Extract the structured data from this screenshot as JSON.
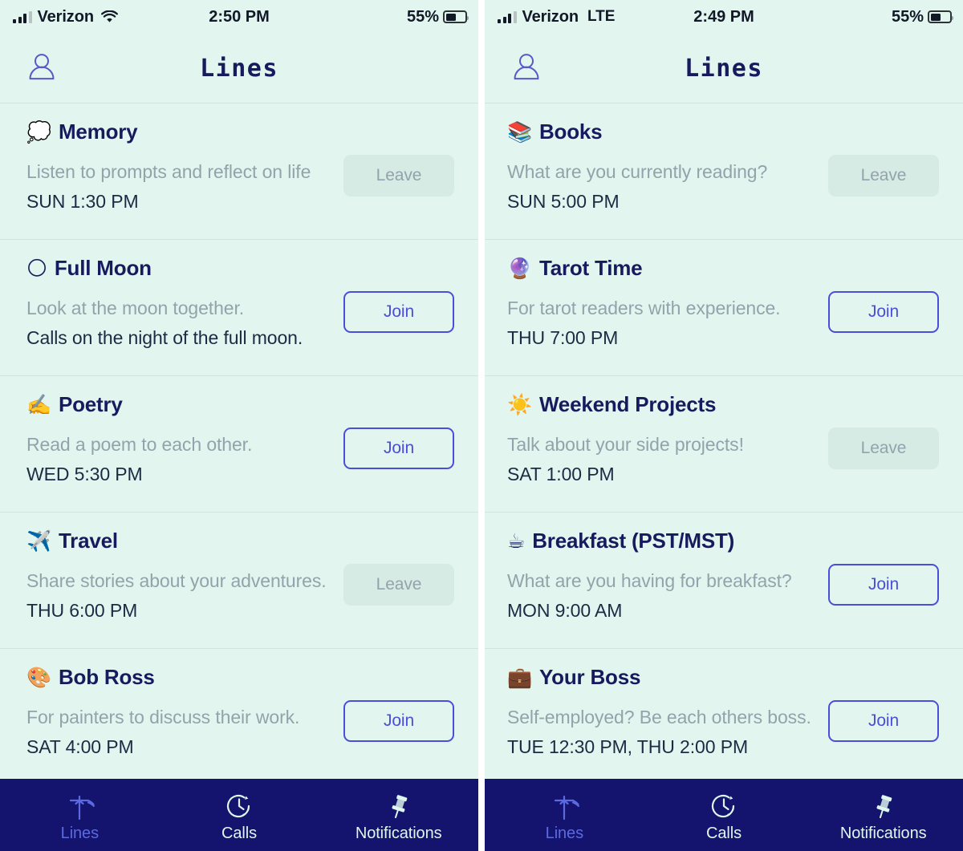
{
  "app": {
    "title": "Lines",
    "accent_indigo": "#4b4ddb",
    "title_navy": "#181a5e",
    "background_mint": "#e2f6ef",
    "tabbar_navy": "#14146e",
    "muted_text": "#93a3ab"
  },
  "panels": [
    {
      "id": "left",
      "status_bar": {
        "carrier": "Verizon",
        "network": "",
        "wifi": true,
        "time": "2:50 PM",
        "battery_percent": "55%",
        "battery_level": 0.55
      },
      "header": {
        "title": "Lines",
        "profile_icon": "person-icon"
      },
      "rows": [
        {
          "emoji": "💭",
          "emoji_name": "thought-balloon-emoji",
          "title": "Memory",
          "subtitle": "Listen to prompts and reflect on life",
          "time": "SUN 1:30 PM",
          "action": "Leave",
          "action_state": "joined"
        },
        {
          "emoji": "🌕",
          "emoji_name": "full-moon-emoji",
          "title": "Full Moon",
          "subtitle": "Look at the moon together.",
          "time": "Calls on the night of the full moon.",
          "action": "Join",
          "action_state": "not-joined"
        },
        {
          "emoji": "✍️",
          "emoji_name": "writing-hand-emoji",
          "title": "Poetry",
          "subtitle": "Read a poem to each other.",
          "time": "WED 5:30 PM",
          "action": "Join",
          "action_state": "not-joined"
        },
        {
          "emoji": "✈️",
          "emoji_name": "airplane-emoji",
          "title": "Travel",
          "subtitle": "Share stories about your adventures.",
          "time": "THU 6:00 PM",
          "action": "Leave",
          "action_state": "joined"
        },
        {
          "emoji": "🎨",
          "emoji_name": "artist-palette-emoji",
          "title": "Bob Ross",
          "subtitle": "For painters to discuss their work.",
          "time": "SAT 4:00 PM",
          "action": "Join",
          "action_state": "not-joined"
        }
      ],
      "tabs": [
        {
          "label": "Lines",
          "icon": "utility-pole-icon",
          "active": true
        },
        {
          "label": "Calls",
          "icon": "clock-history-icon",
          "active": false
        },
        {
          "label": "Notifications",
          "icon": "pushpin-icon",
          "active": false
        }
      ]
    },
    {
      "id": "right",
      "status_bar": {
        "carrier": "Verizon",
        "network": "LTE",
        "wifi": false,
        "time": "2:49 PM",
        "battery_percent": "55%",
        "battery_level": 0.55
      },
      "header": {
        "title": "Lines",
        "profile_icon": "person-icon"
      },
      "rows": [
        {
          "emoji": "📚",
          "emoji_name": "books-emoji",
          "title": "Books",
          "subtitle": "What are you currently reading?",
          "time": "SUN 5:00 PM",
          "action": "Leave",
          "action_state": "joined"
        },
        {
          "emoji": "🔮",
          "emoji_name": "crystal-ball-emoji",
          "title": "Tarot Time",
          "subtitle": "For tarot readers with experience.",
          "time": "THU 7:00 PM",
          "action": "Join",
          "action_state": "not-joined"
        },
        {
          "emoji": "☀️",
          "emoji_name": "sun-emoji",
          "title": "Weekend Projects",
          "subtitle": "Talk about your side projects!",
          "time": "SAT 1:00 PM",
          "action": "Leave",
          "action_state": "joined"
        },
        {
          "emoji": "☕",
          "emoji_name": "hot-beverage-emoji",
          "title": "Breakfast (PST/MST)",
          "subtitle": "What are you having for breakfast?",
          "time": "MON 9:00 AM",
          "action": "Join",
          "action_state": "not-joined"
        },
        {
          "emoji": "💼",
          "emoji_name": "briefcase-emoji",
          "title": "Your Boss",
          "subtitle": "Self-employed? Be each others boss.",
          "time": "TUE 12:30 PM, THU 2:00 PM",
          "action": "Join",
          "action_state": "not-joined"
        }
      ],
      "tabs": [
        {
          "label": "Lines",
          "icon": "utility-pole-icon",
          "active": true
        },
        {
          "label": "Calls",
          "icon": "clock-history-icon",
          "active": false
        },
        {
          "label": "Notifications",
          "icon": "pushpin-icon",
          "active": false
        }
      ]
    }
  ]
}
